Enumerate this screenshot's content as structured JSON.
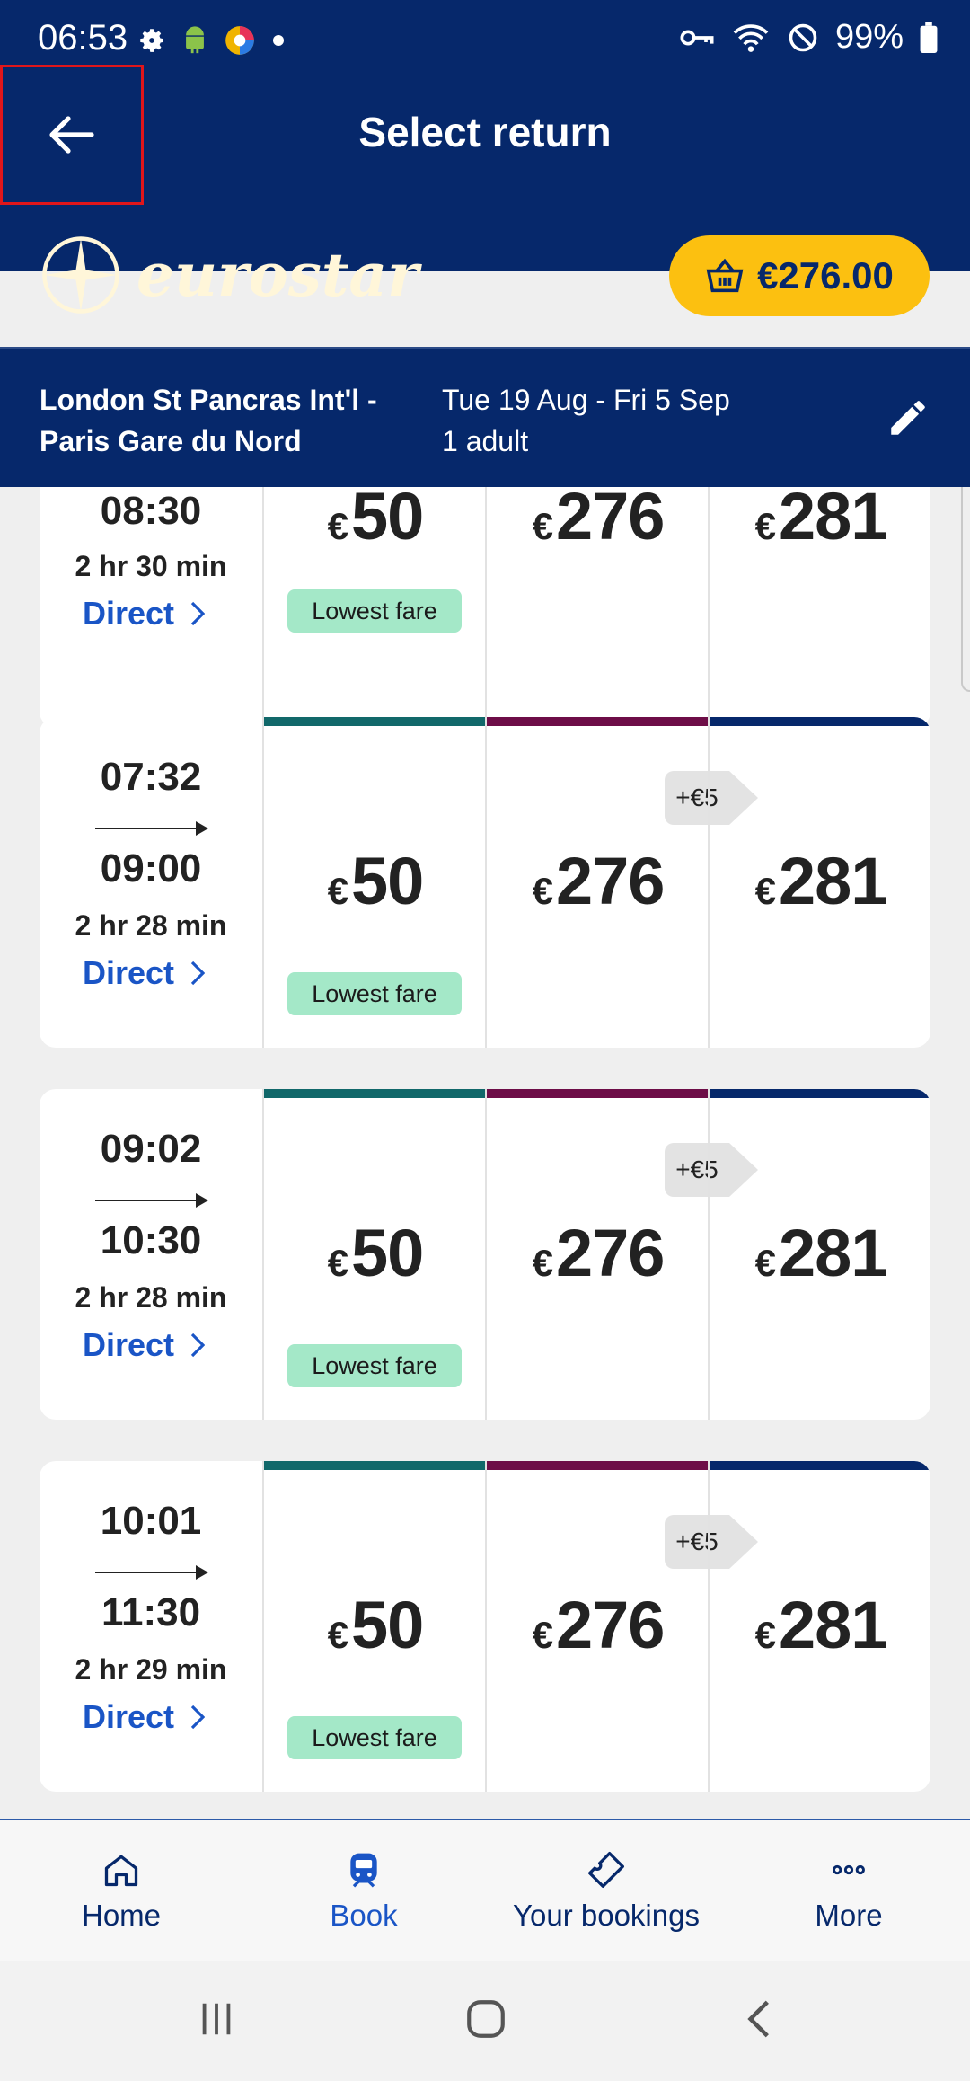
{
  "status_bar": {
    "time": "06:53",
    "battery": "99%"
  },
  "header": {
    "title": "Select return",
    "brand": "eurostar",
    "basket_total": "€276.00"
  },
  "journey": {
    "route_line1": "London St Pancras Int'l -",
    "route_line2": "Paris Gare du Nord",
    "dates": "Tue 19 Aug - Fri 5 Sep",
    "passengers": "1 adult"
  },
  "colors": {
    "standard": "#11686a",
    "plus": "#6d0d47",
    "premier": "#06286b",
    "brand_navy": "#06286b",
    "basket_yellow": "#fcc010",
    "lowest_fare_green": "#a4e8c8"
  },
  "currency": "€",
  "trains": [
    {
      "depart": "",
      "arrive": "08:30",
      "duration": "2 hr 30 min",
      "type": "Direct",
      "standard": "50",
      "plus": "276",
      "premier": "281",
      "lowest_label": "Lowest fare",
      "upsell": ""
    },
    {
      "depart": "07:32",
      "arrive": "09:00",
      "duration": "2 hr 28 min",
      "type": "Direct",
      "standard": "50",
      "plus": "276",
      "premier": "281",
      "lowest_label": "Lowest fare",
      "upsell": "+€5"
    },
    {
      "depart": "09:02",
      "arrive": "10:30",
      "duration": "2 hr 28 min",
      "type": "Direct",
      "standard": "50",
      "plus": "276",
      "premier": "281",
      "lowest_label": "Lowest fare",
      "upsell": "+€5"
    },
    {
      "depart": "10:01",
      "arrive": "11:30",
      "duration": "2 hr 29 min",
      "type": "Direct",
      "standard": "50",
      "plus": "276",
      "premier": "281",
      "lowest_label": "Lowest fare",
      "upsell": "+€5"
    }
  ],
  "bottom_nav": {
    "home": "Home",
    "book": "Book",
    "bookings": "Your bookings",
    "more": "More"
  }
}
